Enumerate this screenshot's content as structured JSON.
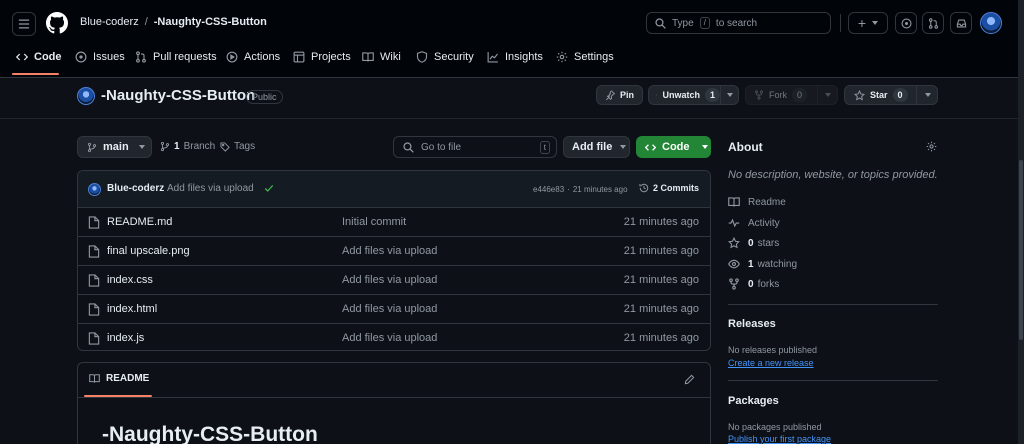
{
  "header": {
    "owner": "Blue-coderz",
    "separator": "/",
    "repo": "-Naughty-CSS-Button",
    "search_prefix": "Type",
    "search_key": "/",
    "search_suffix": "to search",
    "new_plus": "+"
  },
  "tabs": [
    {
      "label": "Code",
      "icon": "code-icon"
    },
    {
      "label": "Issues",
      "icon": "issue-icon"
    },
    {
      "label": "Pull requests",
      "icon": "pull-request-icon"
    },
    {
      "label": "Actions",
      "icon": "play-icon"
    },
    {
      "label": "Projects",
      "icon": "table-icon"
    },
    {
      "label": "Wiki",
      "icon": "book-icon"
    },
    {
      "label": "Security",
      "icon": "shield-icon"
    },
    {
      "label": "Insights",
      "icon": "graph-icon"
    },
    {
      "label": "Settings",
      "icon": "gear-icon"
    }
  ],
  "repo": {
    "title": "-Naughty-CSS-Button",
    "visibility": "Public",
    "pin_label": "Pin",
    "unwatch_label": "Unwatch",
    "watch_count": "1",
    "fork_label": "Fork",
    "fork_count": "0",
    "star_label": "Star",
    "star_count": "0"
  },
  "toolbar": {
    "branch": "main",
    "branch_count": "1",
    "branch_label": "Branch",
    "tags_label": "Tags",
    "go_to_file_placeholder": "Go to file",
    "shortcut_key": "t",
    "add_file_label": "Add file",
    "code_label": "Code"
  },
  "commit": {
    "author": "Blue-coderz",
    "message": "Add files via upload",
    "hash": "e446e83",
    "dot": "·",
    "age": "21 minutes ago",
    "commits_label": "2 Commits"
  },
  "files": [
    {
      "name": "README.md",
      "message": "Initial commit",
      "age": "21 minutes ago"
    },
    {
      "name": "final upscale.png",
      "message": "Add files via upload",
      "age": "21 minutes ago"
    },
    {
      "name": "index.css",
      "message": "Add files via upload",
      "age": "21 minutes ago"
    },
    {
      "name": "index.html",
      "message": "Add files via upload",
      "age": "21 minutes ago"
    },
    {
      "name": "index.js",
      "message": "Add files via upload",
      "age": "21 minutes ago"
    }
  ],
  "readme": {
    "tab_label": "README",
    "heading": "-Naughty-CSS-Button"
  },
  "about": {
    "title": "About",
    "description": "No description, website, or topics provided.",
    "readme_label": "Readme",
    "activity_label": "Activity",
    "stars_count": "0",
    "stars_label": "stars",
    "watching_count": "1",
    "watching_label": "watching",
    "forks_count": "0",
    "forks_label": "forks"
  },
  "releases": {
    "title": "Releases",
    "empty_text": "No releases published",
    "create_link": "Create a new release"
  },
  "packages": {
    "title": "Packages",
    "empty_text": "No packages published",
    "publish_link": "Publish your first package"
  },
  "colors": {
    "accent_tab": "#f78166",
    "code_button": "#238636",
    "link": "#4493f8",
    "success": "#3fb950"
  }
}
